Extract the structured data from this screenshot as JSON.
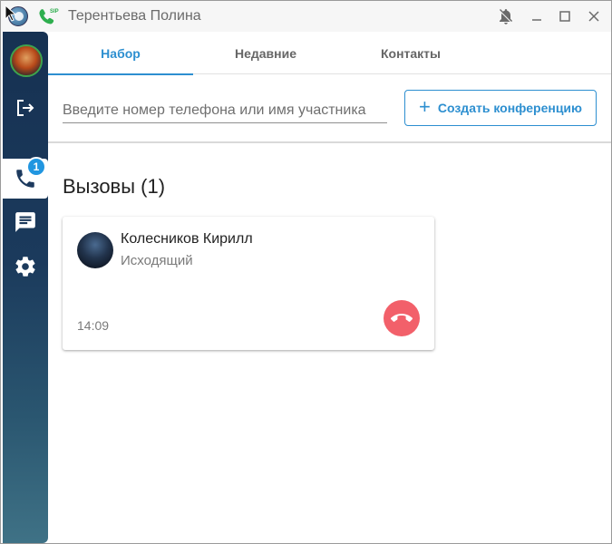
{
  "window": {
    "title": "Терентьева Полина"
  },
  "tabs": [
    {
      "label": "Набор",
      "active": true
    },
    {
      "label": "Недавние",
      "active": false
    },
    {
      "label": "Контакты",
      "active": false
    }
  ],
  "dial": {
    "placeholder": "Введите номер телефона или имя участника",
    "value": "",
    "conference_button": "Создать конференцию"
  },
  "sidebar": {
    "calls_badge": "1",
    "items": [
      "avatar",
      "logout-icon",
      "phone-icon",
      "chat-icon",
      "gear-icon"
    ]
  },
  "calls": {
    "heading": "Вызовы (1)",
    "items": [
      {
        "name": "Колесников Кирилл",
        "status": "Исходящий",
        "time": "14:09"
      }
    ]
  },
  "colors": {
    "accent": "#2d8fd0",
    "hangup": "#f2606a",
    "badge": "#2196e0",
    "sidebar_top": "#163152",
    "sidebar_bottom": "#3f7286"
  }
}
